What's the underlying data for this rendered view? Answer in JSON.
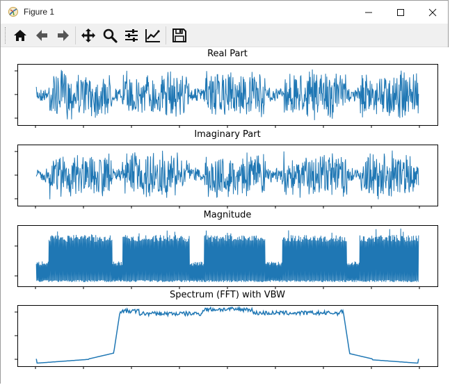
{
  "window": {
    "title": "Figure 1",
    "icons": [
      "matplotlib-app-icon",
      "minimize-icon",
      "maximize-icon",
      "close-icon"
    ]
  },
  "toolbar": {
    "items": [
      {
        "name": "home-icon",
        "tooltip": "Reset original view"
      },
      {
        "name": "back-arrow-icon",
        "tooltip": "Back to previous view"
      },
      {
        "name": "forward-arrow-icon",
        "tooltip": "Forward to next view"
      },
      {
        "name": "pan-move-icon",
        "tooltip": "Pan axes"
      },
      {
        "name": "zoom-magnifier-icon",
        "tooltip": "Zoom to rectangle"
      },
      {
        "name": "configure-subplots-icon",
        "tooltip": "Configure subplots"
      },
      {
        "name": "edit-axis-icon",
        "tooltip": "Edit axis, curve and image parameters"
      },
      {
        "name": "save-disk-icon",
        "tooltip": "Save the figure"
      }
    ]
  },
  "colors": {
    "line": "#1f77b4",
    "axes": "#000000",
    "toolbar_bg": "#f0f0f0"
  },
  "chart_data": [
    {
      "type": "line",
      "title": "Real Part",
      "xlabel": "",
      "ylabel": "",
      "x_ticks": 9,
      "y_ticks": 3,
      "bursts": [
        [
          0.09,
          0.28
        ],
        [
          0.28,
          0.48
        ],
        [
          0.48,
          0.68
        ],
        [
          0.68,
          0.88
        ],
        [
          0.88,
          1.0
        ]
      ],
      "gaps_active_fraction": [
        [
          0.05,
          0.09
        ],
        [
          0.28,
          0.29
        ],
        [
          0.48,
          0.49
        ],
        [
          0.68,
          0.69
        ],
        [
          0.88,
          0.89
        ],
        [
          0.97,
          0.98
        ]
      ],
      "burst_amplitude": 0.95,
      "idle_amplitude": 0.25,
      "active_x_range": [
        0.05,
        0.98
      ]
    },
    {
      "type": "line",
      "title": "Imaginary Part",
      "xlabel": "",
      "ylabel": "",
      "x_ticks": 9,
      "y_ticks": 3,
      "burst_amplitude": 0.95,
      "idle_amplitude": 0.25,
      "active_x_range": [
        0.05,
        0.98
      ]
    },
    {
      "type": "line",
      "title": "Magnitude",
      "xlabel": "",
      "ylabel": "",
      "x_ticks": 9,
      "y_ticks": 2,
      "burst_level": 0.85,
      "idle_level": 0.35,
      "active_x_range": [
        0.05,
        0.98
      ]
    },
    {
      "type": "line",
      "title": "Spectrum (FFT) with VBW",
      "xlabel": "",
      "ylabel": "",
      "x_ticks": 9,
      "y_ticks": 3,
      "shape": "flat-top passband with sloped skirts",
      "passband": [
        0.2,
        0.8
      ]
    }
  ]
}
